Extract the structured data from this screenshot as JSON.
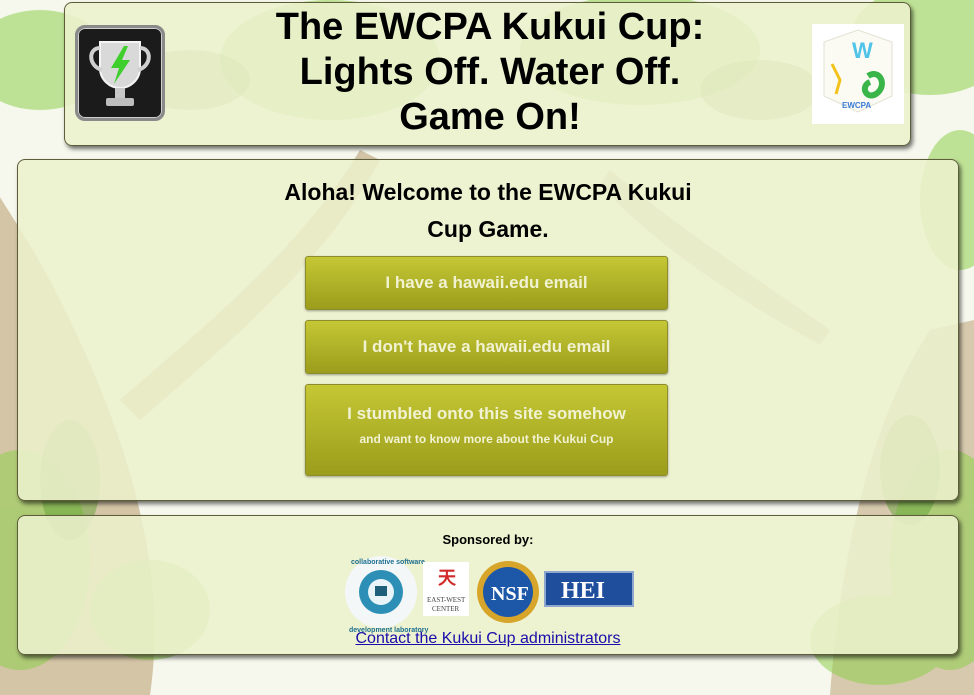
{
  "header": {
    "title_lines": [
      "The EWCPA Kukui Cup:",
      "Lights Off. Water Off.",
      "Game On!"
    ],
    "cube_logo_text": "EWCPA"
  },
  "main": {
    "welcome_lines": [
      "Aloha! Welcome to the EWCPA Kukui",
      "Cup Game."
    ],
    "buttons": {
      "hawaii_email": "I have a hawaii.edu email",
      "no_hawaii_email": "I don't have a hawaii.edu email",
      "stumbled_main": "I stumbled onto this site somehow",
      "stumbled_sub": "and want to know more about the Kukui Cup"
    }
  },
  "footer": {
    "sponsored_label": "Sponsored by:",
    "sponsors": {
      "csdl_text_top": "collaborative software",
      "csdl_text_bottom": "development laboratory",
      "ewc_line1": "EAST-WEST",
      "ewc_line2": "CENTER",
      "nsf": "NSF",
      "hei": "HEI"
    },
    "contact_link": "Contact the Kukui Cup administrators"
  },
  "colors": {
    "panel_bg": "#ecf0cc",
    "button_top": "#c5c735",
    "button_bottom": "#9b9d1c",
    "button_text": "#f1f2d2",
    "link": "#1a0dab"
  },
  "icons": [
    "trophy-lightning-icon",
    "cube-logo",
    "csdl-logo",
    "east-west-center-logo",
    "nsf-logo",
    "hei-logo"
  ]
}
